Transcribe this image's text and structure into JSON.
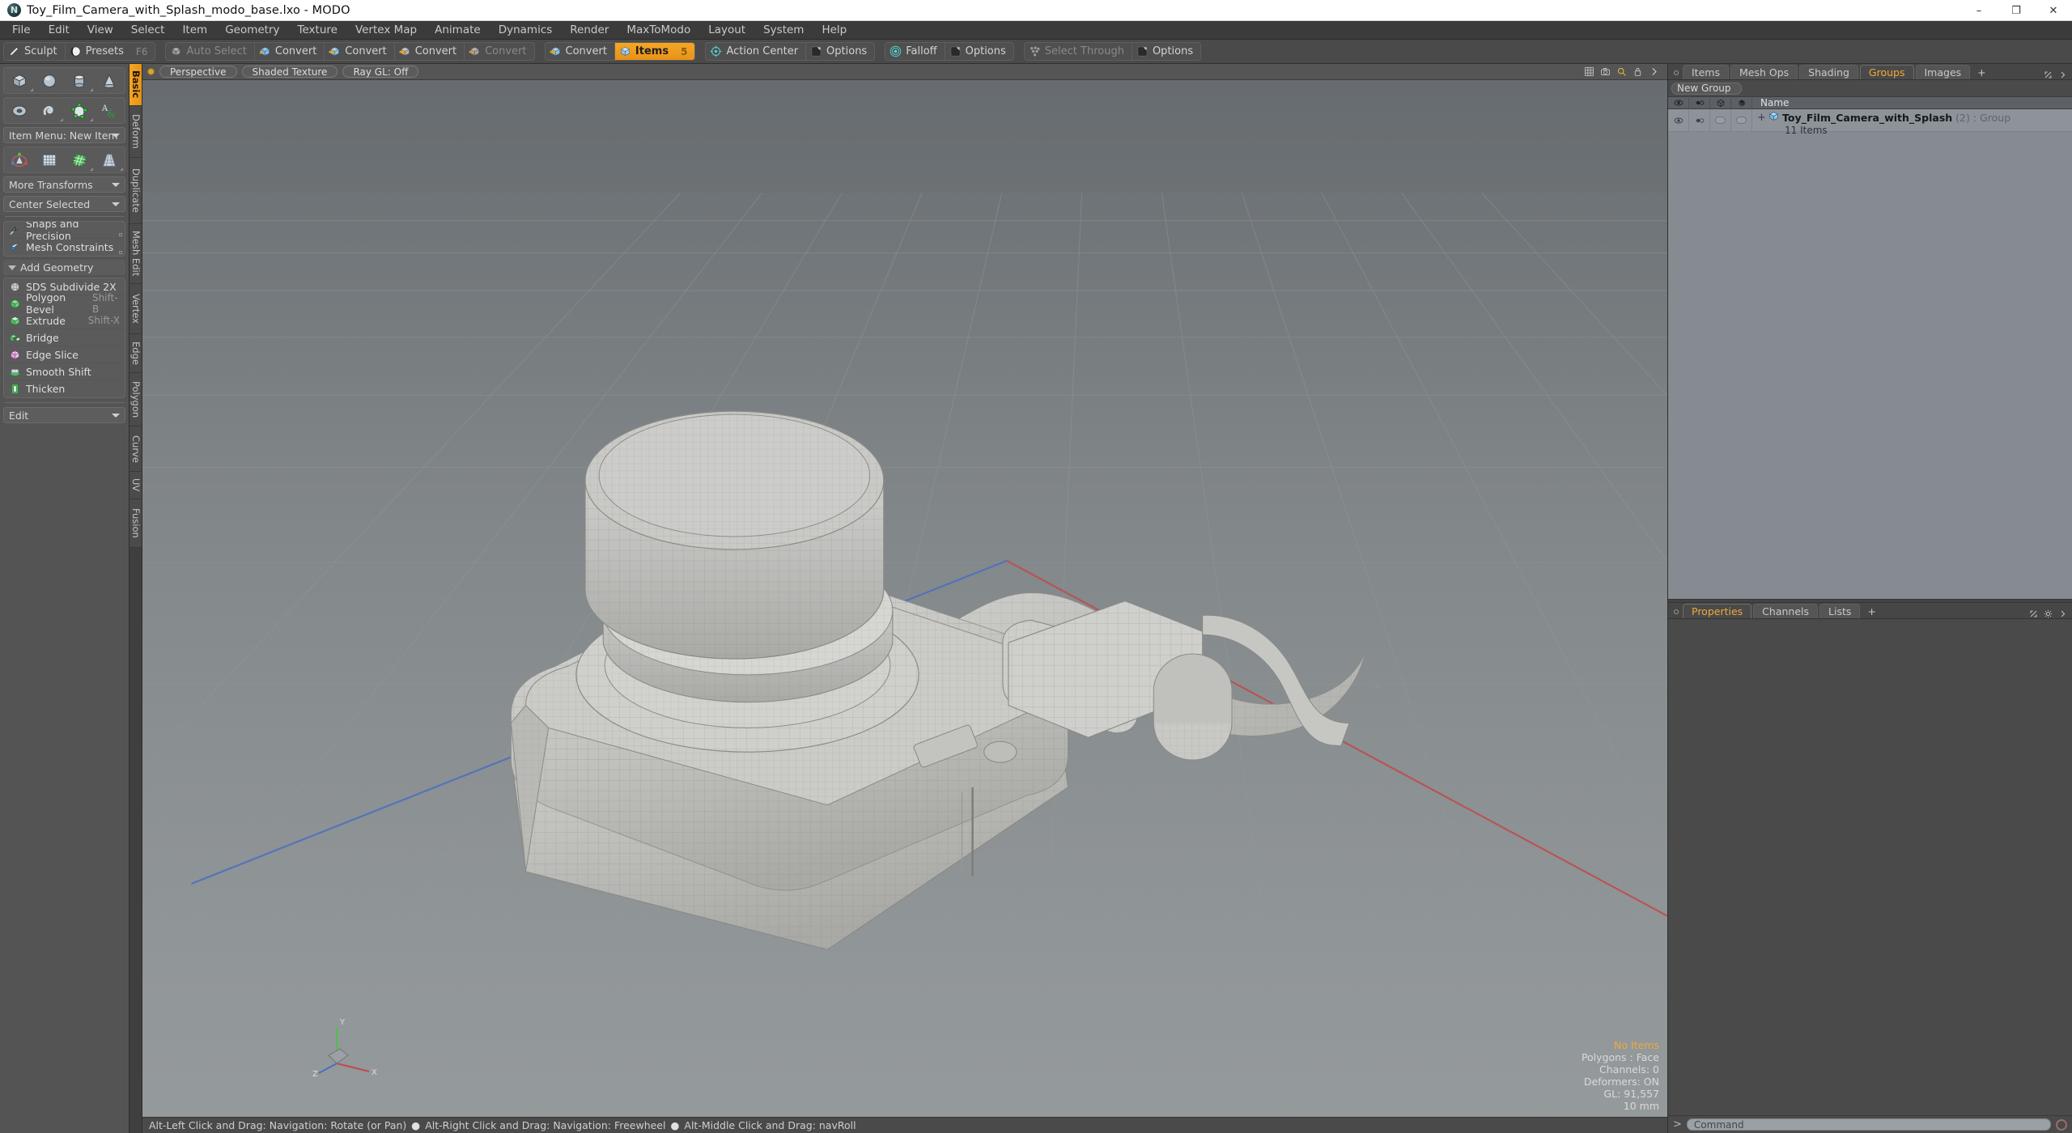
{
  "window": {
    "title": "Toy_Film_Camera_with_Splash_modo_base.lxo - MODO",
    "app_icon": "modo-logo-icon",
    "minimize": "–",
    "maximize": "❐",
    "close": "✕"
  },
  "menubar": {
    "items": [
      "File",
      "Edit",
      "View",
      "Select",
      "Item",
      "Geometry",
      "Texture",
      "Vertex Map",
      "Animate",
      "Dynamics",
      "Render",
      "MaxToModo",
      "Layout",
      "System",
      "Help"
    ]
  },
  "toolbar": {
    "groups": [
      {
        "buttons": [
          {
            "label": "Sculpt",
            "icon": "pencil-icon",
            "state": "normal",
            "shortcut": ""
          },
          {
            "label": "Presets",
            "icon": "sphere-icon",
            "state": "normal",
            "shortcut": "F6"
          }
        ]
      },
      {
        "buttons": [
          {
            "label": "Auto Select",
            "icon": "cube-grey-icon",
            "state": "dim",
            "shortcut": ""
          },
          {
            "label": "Convert",
            "icon": "cube-vertex-icon",
            "state": "normal",
            "shortcut": ""
          },
          {
            "label": "Convert",
            "icon": "cube-edge-icon",
            "state": "normal",
            "shortcut": ""
          },
          {
            "label": "Convert",
            "icon": "cube-poly-icon",
            "state": "normal",
            "shortcut": ""
          },
          {
            "label": "Convert",
            "icon": "cube-mat-icon",
            "state": "dim",
            "shortcut": ""
          }
        ]
      },
      {
        "buttons": [
          {
            "label": "Convert",
            "icon": "cube-item-icon",
            "state": "normal",
            "shortcut": ""
          },
          {
            "label": "Items",
            "icon": "cube-blue-icon",
            "state": "active",
            "shortcut": "5"
          }
        ]
      },
      {
        "buttons": [
          {
            "label": "Action Center",
            "icon": "target-icon",
            "state": "normal",
            "shortcut": ""
          },
          {
            "label": "Options",
            "icon": "square-options-icon",
            "state": "normal",
            "shortcut": ""
          }
        ]
      },
      {
        "buttons": [
          {
            "label": "Falloff",
            "icon": "falloff-icon",
            "state": "normal",
            "shortcut": ""
          },
          {
            "label": "Options",
            "icon": "square-options-icon",
            "state": "normal",
            "shortcut": ""
          }
        ]
      },
      {
        "buttons": [
          {
            "label": "Select Through",
            "icon": "select-through-icon",
            "state": "dim",
            "shortcut": ""
          },
          {
            "label": "Options",
            "icon": "square-options-icon",
            "state": "normal",
            "shortcut": ""
          }
        ]
      }
    ]
  },
  "left_panel": {
    "primitive_row_1": [
      {
        "name": "cube-primitive-icon"
      },
      {
        "name": "sphere-primitive-icon"
      },
      {
        "name": "cylinder-primitive-icon"
      },
      {
        "name": "cone-primitive-icon"
      }
    ],
    "primitive_row_2": [
      {
        "name": "torus-primitive-icon"
      },
      {
        "name": "spiral-primitive-icon"
      },
      {
        "name": "polygon-pen-icon"
      },
      {
        "name": "text-tool-icon"
      }
    ],
    "item_menu_label": "Item Menu: New Item",
    "transform_row": [
      {
        "name": "transform-gizmo-icon"
      },
      {
        "name": "bend-mesh-icon"
      },
      {
        "name": "shear-mesh-icon"
      },
      {
        "name": "taper-mesh-icon"
      }
    ],
    "more_transforms_label": "More Transforms",
    "center_selected_label": "Center Selected",
    "snaps_label": "Snaps and Precision",
    "mesh_constraints_label": "Mesh Constraints",
    "add_geometry_label": "Add Geometry",
    "geometry_items": [
      {
        "label": "SDS Subdivide 2X",
        "shortcut": "",
        "icon": "subdivide-icon"
      },
      {
        "label": "Polygon Bevel",
        "shortcut": "Shift-B",
        "icon": "bevel-icon"
      },
      {
        "label": "Extrude",
        "shortcut": "Shift-X",
        "icon": "extrude-icon"
      },
      {
        "label": "Bridge",
        "shortcut": "",
        "icon": "bridge-icon"
      },
      {
        "label": "Edge Slice",
        "shortcut": "",
        "icon": "edge-slice-icon"
      },
      {
        "label": "Smooth Shift",
        "shortcut": "",
        "icon": "smooth-shift-icon"
      },
      {
        "label": "Thicken",
        "shortcut": "",
        "icon": "thicken-icon"
      }
    ],
    "edit_label": "Edit",
    "vertical_tabs": [
      {
        "label": "Basic",
        "active": true
      },
      {
        "label": "Deform",
        "active": false
      },
      {
        "label": "Duplicate",
        "active": false
      },
      {
        "label": "Mesh Edit",
        "active": false
      },
      {
        "label": "Vertex",
        "active": false
      },
      {
        "label": "Edge",
        "active": false
      },
      {
        "label": "Polygon",
        "active": false
      },
      {
        "label": "Curve",
        "active": false
      },
      {
        "label": "UV",
        "active": false
      },
      {
        "label": "Fusion",
        "active": false
      }
    ]
  },
  "viewport": {
    "header_pills": [
      "Perspective",
      "Shaded Texture",
      "Ray GL: Off"
    ],
    "header_icons": [
      "grid-icon",
      "camera-icon",
      "search-icon",
      "lock-icon",
      "chevron-right-icon"
    ],
    "axis_labels": {
      "y": "Y",
      "x": "X",
      "z": "Z"
    },
    "stats": {
      "selection": "No Items",
      "polygons": "Polygons : Face",
      "channels": "Channels: 0",
      "deformers": "Deformers: ON",
      "gl": "GL: 91,557",
      "grid": "10 mm"
    }
  },
  "statusbar": {
    "hints": [
      "Alt-Left Click and Drag: Navigation: Rotate (or Pan)",
      "Alt-Right Click and Drag: Navigation: Freewheel",
      "Alt-Middle Click and Drag: navRoll"
    ],
    "separator": "●"
  },
  "right_panel": {
    "tabs": [
      {
        "label": "Items",
        "active": false
      },
      {
        "label": "Mesh Ops",
        "active": false
      },
      {
        "label": "Shading",
        "active": false
      },
      {
        "label": "Groups",
        "active": true
      },
      {
        "label": "Images",
        "active": false
      },
      {
        "label": "+",
        "active": false
      }
    ],
    "new_group_label": "New Group",
    "tree_columns": [
      {
        "icon": "eye-icon"
      },
      {
        "icon": "render-eye-icon"
      },
      {
        "icon": "wire-cube-icon"
      },
      {
        "icon": "solid-cube-icon"
      },
      {
        "label": "Name"
      }
    ],
    "tree_rows": [
      {
        "expander": "+",
        "icon": "group-cube-icon",
        "name": "Toy_Film_Camera_with_Splash",
        "count": "(2)",
        "type": ": Group",
        "sub": "11 Items"
      }
    ],
    "bottom_tabs": [
      {
        "label": "Properties",
        "active": true
      },
      {
        "label": "Channels",
        "active": false
      },
      {
        "label": "Lists",
        "active": false
      },
      {
        "label": "+",
        "active": false
      }
    ],
    "command": {
      "caret": ">",
      "placeholder": "Command"
    }
  },
  "colors": {
    "accent": "#f0a93b",
    "panel_bg": "#4a4a4a",
    "left_bg": "#545454",
    "tree_bg": "#8d9399",
    "menu_bg": "#3b3b3b",
    "axis_x": "#c04a4a",
    "axis_z": "#4a6fc0",
    "axis_y": "#5ec04a"
  }
}
